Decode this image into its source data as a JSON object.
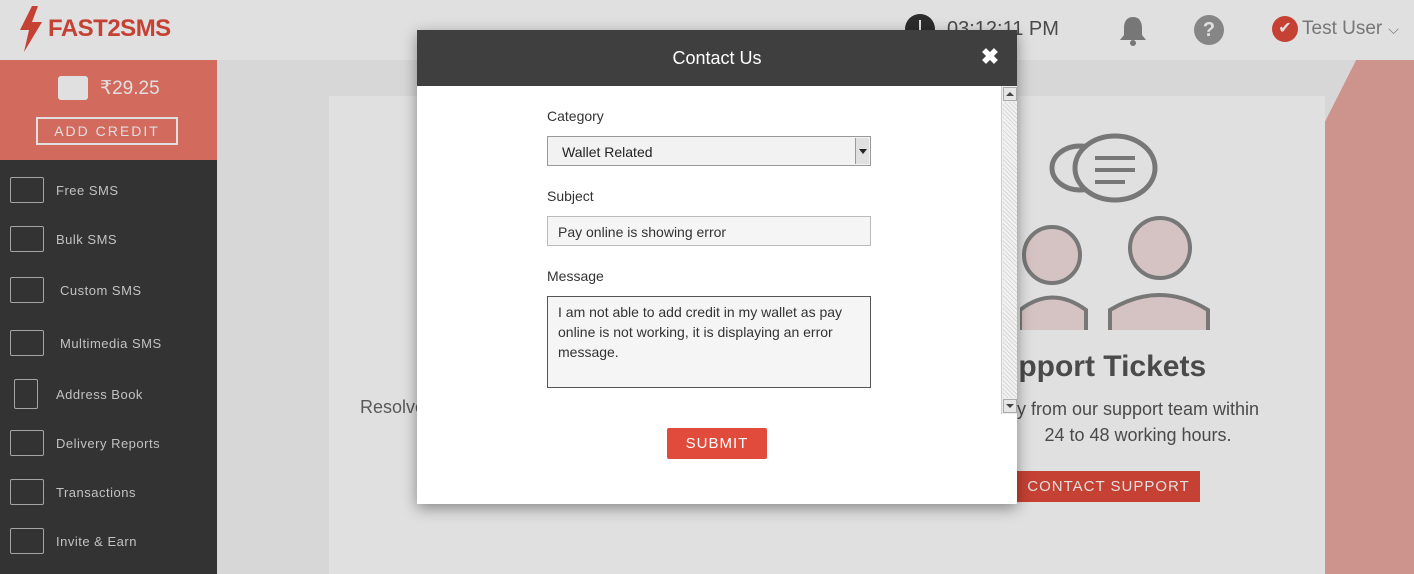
{
  "header": {
    "logo": "FAST2SMS",
    "clock": "03:12:11 PM",
    "user_name": "Test User"
  },
  "wallet": {
    "balance": "₹29.25",
    "add_credit_label": "ADD CREDIT"
  },
  "sidebar": {
    "items": [
      {
        "label": "Free SMS",
        "icon": "envelope-icon"
      },
      {
        "label": "Bulk SMS",
        "icon": "envelopes-icon"
      },
      {
        "label": "Custom SMS",
        "icon": "envelope-gear-icon"
      },
      {
        "label": "Multimedia SMS",
        "icon": "envelope-plus-icon"
      },
      {
        "label": "Address Book",
        "icon": "address-book-icon"
      },
      {
        "label": "Delivery Reports",
        "icon": "chart-icon"
      },
      {
        "label": "Transactions",
        "icon": "transactions-icon"
      },
      {
        "label": "Invite & Earn",
        "icon": "invite-icon"
      }
    ]
  },
  "background": {
    "left_text": "Resolve",
    "support_title": "upport Tickets",
    "support_desc": "y from our support team within 24 to 48 working hours.",
    "contact_support_label": "CONTACT SUPPORT"
  },
  "modal": {
    "title": "Contact Us",
    "close_icon": "close-icon",
    "category_label": "Category",
    "category_value": "Wallet Related",
    "subject_label": "Subject",
    "subject_value": "Pay online is showing error",
    "message_label": "Message",
    "message_value": "I am not able to add credit in my wallet as pay online is not working, it is displaying an error message.",
    "submit_label": "SUBMIT"
  },
  "colors": {
    "brand": "#e14b3b",
    "modal_header": "#3f3f3f",
    "sidebar": "#3b3b3b"
  }
}
